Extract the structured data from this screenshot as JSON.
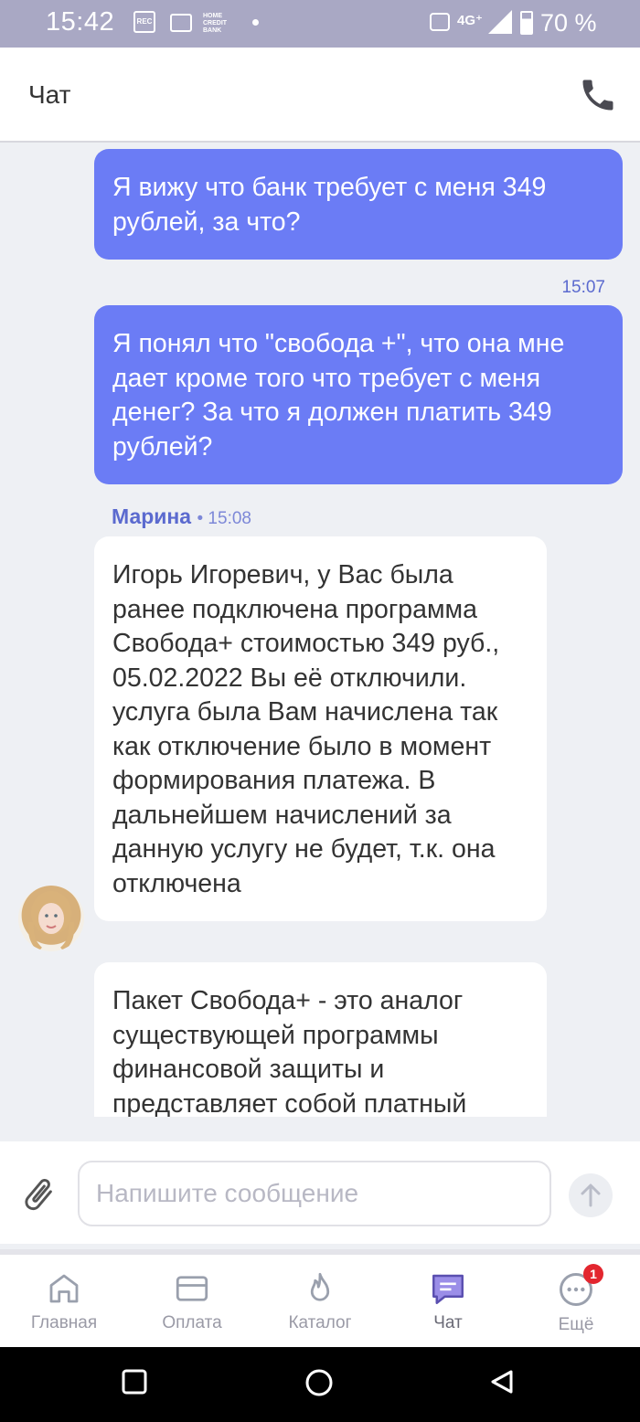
{
  "status_bar": {
    "time": "15:42",
    "rec_label": "REC",
    "bank_label": "HOME CREDIT BANK",
    "network": "4G⁺",
    "battery": "70 %"
  },
  "header": {
    "title": "Чат",
    "call_icon": "phone-icon"
  },
  "messages": {
    "m1": {
      "text": "Я вижу что банк требует с меня 349 рублей, за что?"
    },
    "m2": {
      "time": "15:07",
      "text": "Я понял что \"свобода +\", что она мне дает кроме того что требует с меня денег? За что я должен платить 349 рублей?"
    },
    "m3": {
      "sender": "Марина",
      "time": "• 15:08",
      "text": "Игорь Игоревич, у Вас была ранее подключена программа Свобода+ стоимостью 349 руб., 05.02.2022 Вы её отключили. услуга была Вам начислена так как отключение было в момент формирования платежа. В дальнейшем начислений за данную услугу не будет, т.к. она отключена"
    },
    "m4": {
      "text": "Пакет Свобода+ - это аналог существующей программы финансовой защиты и представляет собой платный"
    }
  },
  "input": {
    "placeholder": "Напишите сообщение",
    "value": ""
  },
  "nav": {
    "home": "Главная",
    "payment": "Оплата",
    "catalog": "Каталог",
    "chat": "Чат",
    "more": "Ещё",
    "more_badge": "1"
  },
  "colors": {
    "accent": "#6b7cf5",
    "status_bar": "#a9a8c4",
    "badge": "#e3262f"
  }
}
